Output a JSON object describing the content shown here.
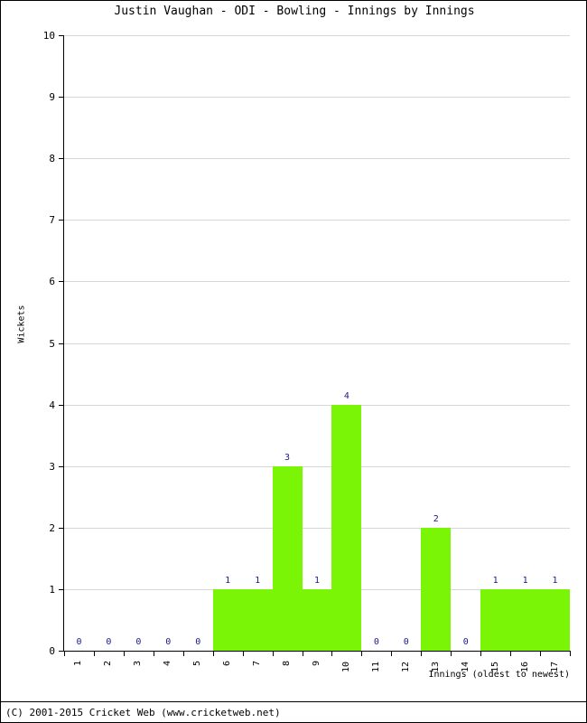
{
  "title": "Justin Vaughan - ODI - Bowling - Innings by Innings",
  "footer": "(C) 2001-2015 Cricket Web (www.cricketweb.net)",
  "axes": {
    "ylabel": "Wickets",
    "xlabel": "Innings (oldest to newest)"
  },
  "chart_data": {
    "type": "bar",
    "title": "Justin Vaughan - ODI - Bowling - Innings by Innings",
    "xlabel": "Innings (oldest to newest)",
    "ylabel": "Wickets",
    "ylim": [
      0,
      10
    ],
    "yticks": [
      0,
      1,
      2,
      3,
      4,
      5,
      6,
      7,
      8,
      9,
      10
    ],
    "ytick_labels": [
      "0",
      "1",
      "2",
      "3",
      "4",
      "5",
      "6",
      "7",
      "8",
      "9",
      "10"
    ],
    "grid": true,
    "legend": null,
    "bar_color": "#79f505",
    "label_color": "#1a1a8c",
    "categories": [
      "1",
      "2",
      "3",
      "4",
      "5",
      "6",
      "7",
      "8",
      "9",
      "10",
      "11",
      "12",
      "13",
      "14",
      "15",
      "16",
      "17"
    ],
    "values": [
      0,
      0,
      0,
      0,
      0,
      1,
      1,
      3,
      1,
      4,
      0,
      0,
      2,
      0,
      1,
      1,
      1
    ],
    "point_labels": [
      "0",
      "0",
      "0",
      "0",
      "0",
      "1",
      "1",
      "3",
      "1",
      "4",
      "0",
      "0",
      "2",
      "0",
      "1",
      "1",
      "1"
    ]
  }
}
